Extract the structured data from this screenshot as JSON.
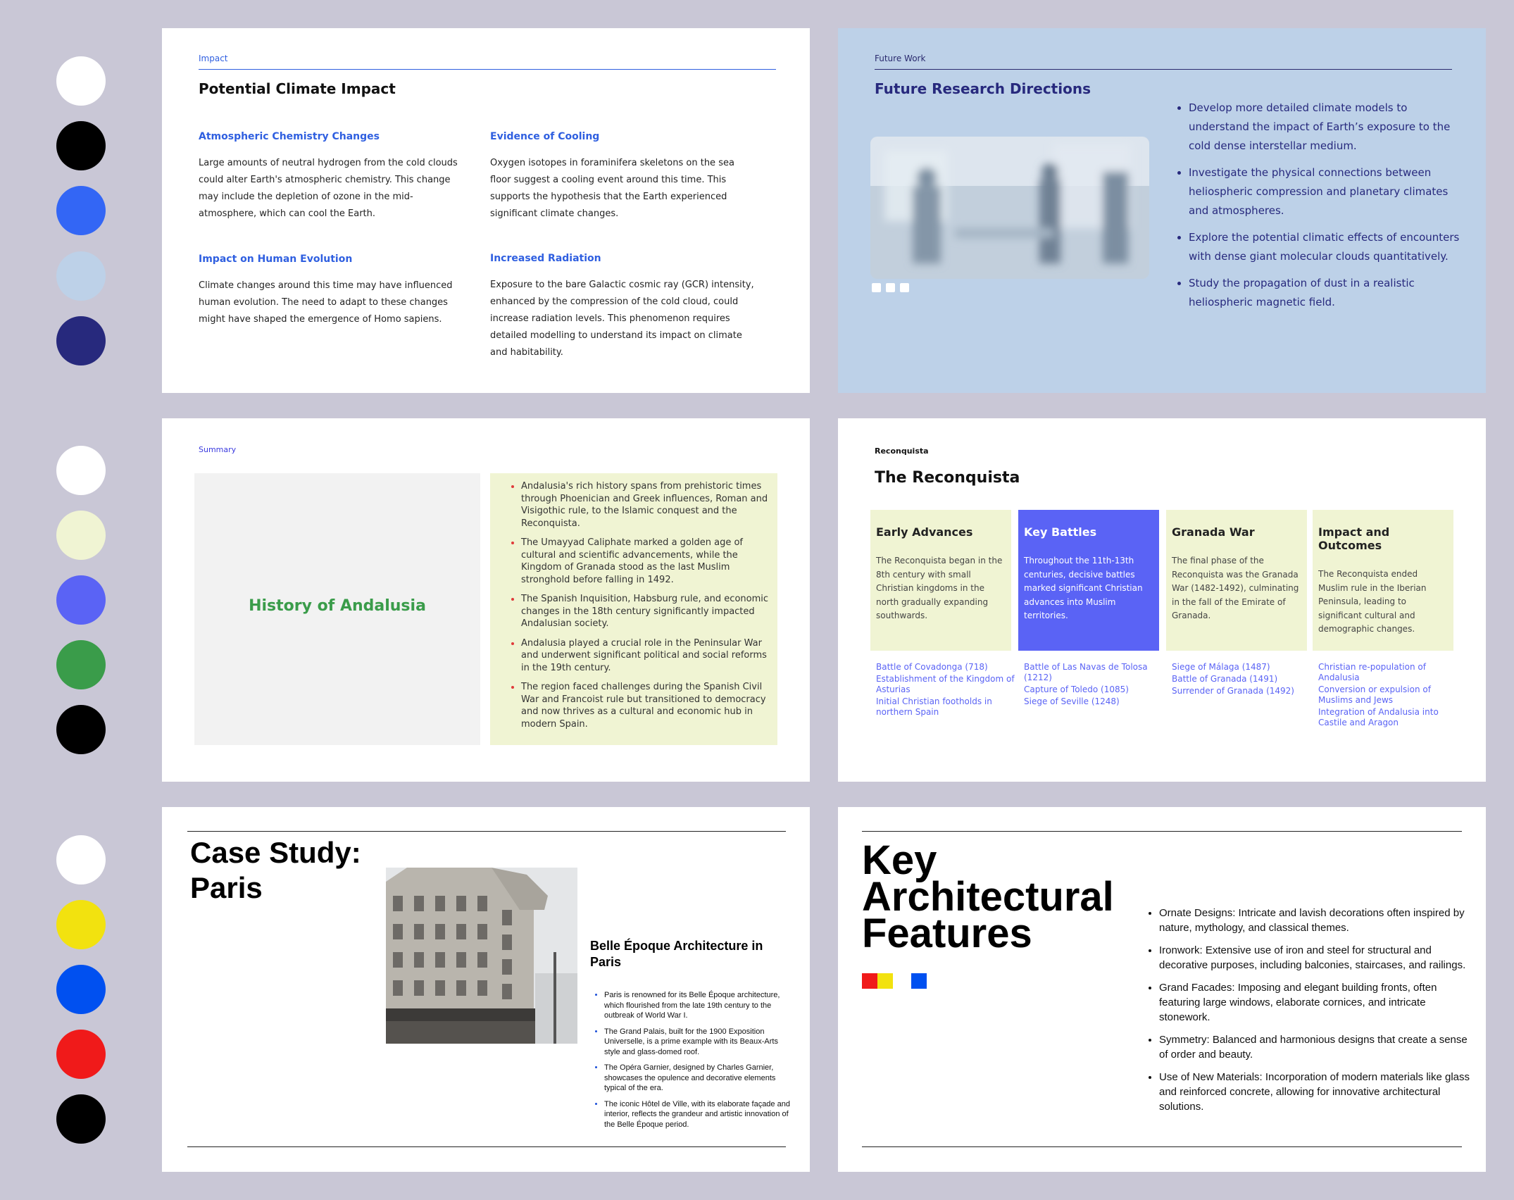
{
  "palettes": {
    "row1": [
      "#ffffff",
      "#000000",
      "#3366f5",
      "#bdd1e8",
      "#27297d"
    ],
    "row2": [
      "#ffffff",
      "#f0f4d3",
      "#5a63f5",
      "#3a9c4a",
      "#000000"
    ],
    "row3": [
      "#ffffff",
      "#f2e20f",
      "#0050f0",
      "#f01a1a",
      "#000000"
    ]
  },
  "slide1": {
    "kicker": "Impact",
    "title": "Potential Climate Impact",
    "sections": [
      {
        "heading": "Atmospheric Chemistry Changes",
        "body": "Large amounts of neutral hydrogen from the cold clouds could alter Earth's atmospheric chemistry. This change may include the depletion of ozone in the mid-atmosphere, which can cool the Earth."
      },
      {
        "heading": "Evidence of Cooling",
        "body": "Oxygen isotopes in foraminifera skeletons on the sea floor suggest a cooling event around this time. This supports the hypothesis that the Earth experienced significant climate changes."
      },
      {
        "heading": "Impact on Human Evolution",
        "body": "Climate changes around this time may have influenced human evolution. The need to adapt to these changes might have shaped the emergence of Homo sapiens."
      },
      {
        "heading": "Increased Radiation",
        "body": "Exposure to the bare Galactic cosmic ray (GCR) intensity, enhanced by the compression of the cold cloud, could increase radiation levels. This phenomenon requires detailed modelling to understand its impact on climate and habitability."
      }
    ]
  },
  "slide2": {
    "kicker": "Future Work",
    "title": "Future Research Directions",
    "bullets": [
      "Develop more detailed climate models to understand the impact of Earth’s exposure to the cold dense interstellar medium.",
      "Investigate the physical connections between heliospheric compression and planetary climates and atmospheres.",
      "Explore the potential climatic effects of encounters with dense giant molecular clouds quantitatively.",
      "Study the propagation of dust in a realistic heliospheric magnetic field."
    ]
  },
  "slide3": {
    "kicker": "Summary",
    "title": "History of Andalusia",
    "bullets": [
      "Andalusia's rich history spans from prehistoric times through Phoenician and Greek influences, Roman and Visigothic rule, to the Islamic conquest and the Reconquista.",
      "The Umayyad Caliphate marked a golden age of cultural and scientific advancements, while the Kingdom of Granada stood as the last Muslim stronghold before falling in 1492.",
      "The Spanish Inquisition, Habsburg rule, and economic changes in the 18th century significantly impacted Andalusian society.",
      "Andalusia played a crucial role in the Peninsular War and underwent significant political and social reforms in the 19th century.",
      "The region faced challenges during the Spanish Civil War and Francoist rule but transitioned to democracy and now thrives as a cultural and economic hub in modern Spain."
    ]
  },
  "slide4": {
    "kicker": "Reconquista",
    "title": "The Reconquista",
    "cards": [
      {
        "title": "Early Advances",
        "body": "The Reconquista began in the 8th century with small Christian kingdoms in the north gradually expanding southwards.",
        "links": [
          "Battle of Covadonga (718)",
          "Establishment of the Kingdom of Asturias",
          "Initial Christian footholds in northern Spain"
        ]
      },
      {
        "title": "Key Battles",
        "body": "Throughout the 11th-13th centuries, decisive battles marked significant Christian advances into Muslim territories.",
        "links": [
          "Battle of Las Navas de Tolosa (1212)",
          "Capture of Toledo (1085)",
          "Siege of Seville (1248)"
        ]
      },
      {
        "title": "Granada War",
        "body": "The final phase of the Reconquista was the Granada War (1482-1492), culminating in the fall of the Emirate of Granada.",
        "links": [
          "Siege of Málaga (1487)",
          "Battle of Granada (1491)",
          "Surrender of Granada (1492)"
        ]
      },
      {
        "title": "Impact and Outcomes",
        "body": "The Reconquista ended Muslim rule in the Iberian Peninsula, leading to significant cultural and demographic changes.",
        "links": [
          "Christian re-population of Andalusia",
          "Conversion or expulsion of Muslims and Jews",
          "Integration of Andalusia into Castile and Aragon"
        ]
      }
    ]
  },
  "slide5": {
    "title": "Case Study: Paris",
    "subheading": "Belle Époque Architecture in Paris",
    "bullets": [
      "Paris is renowned for its Belle Époque architecture, which flourished from the late 19th century to the outbreak of World War I.",
      "The Grand Palais, built for the 1900 Exposition Universelle, is a prime example with its Beaux-Arts style and glass-domed roof.",
      "The Opéra Garnier, designed by Charles Garnier, showcases the opulence and decorative elements typical of the era.",
      "The iconic Hôtel de Ville, with its elaborate façade and interior, reflects the grandeur and artistic innovation of the Belle Époque period."
    ]
  },
  "slide6": {
    "title": "Key Architectural Features",
    "squares": [
      "#f01a1a",
      "#f2e20f",
      "#0050f0"
    ],
    "bullets": [
      "Ornate Designs: Intricate and lavish decorations often inspired by nature, mythology, and classical themes.",
      "Ironwork: Extensive use of iron and steel for structural and decorative purposes, including balconies, staircases, and railings.",
      "Grand Facades: Imposing and elegant building fronts, often featuring large windows, elaborate cornices, and intricate stonework.",
      "Symmetry: Balanced and harmonious designs that create a sense of order and beauty.",
      "Use of New Materials: Incorporation of modern materials like glass and reinforced concrete, allowing for innovative architectural solutions."
    ]
  }
}
